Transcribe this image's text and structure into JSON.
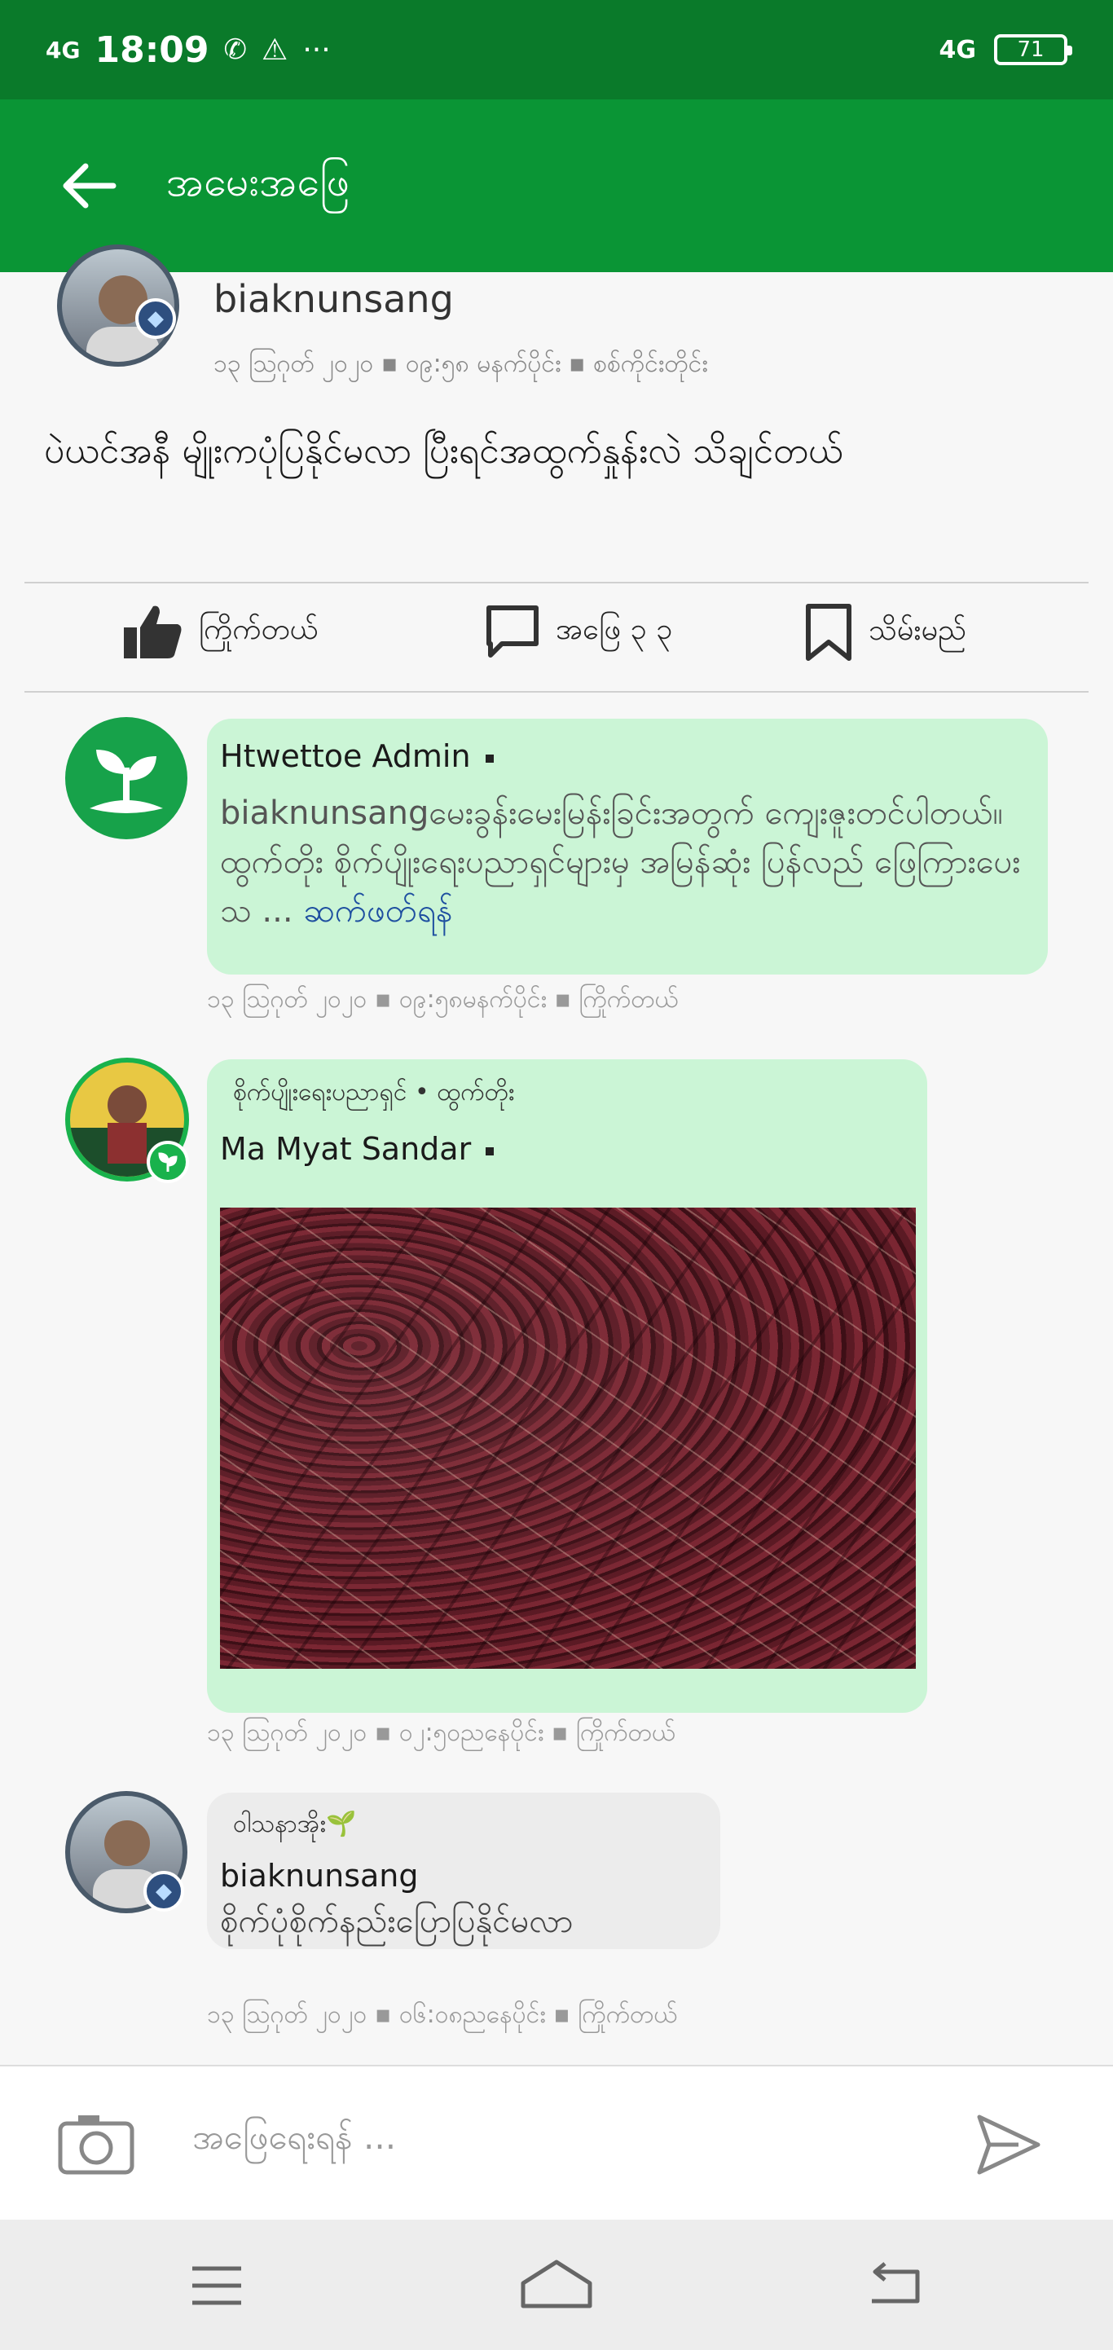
{
  "status": {
    "signal": "4G",
    "time": "18:09",
    "network_right": "4G",
    "battery": "71"
  },
  "header": {
    "title": "အမေးအဖြေ"
  },
  "post": {
    "author": "biaknunsang",
    "meta": "၁၃ ဩဂုတ် ၂၀၂၀ ▪ ၀၉:၅၈ မနက်ပိုင်း ▪ စစ်ကိုင်းတိုင်း",
    "body": "ပဲယင်အနီ မျိုးကပုံပြနိုင်မလာ ပြီးရင်အထွက်နှုန်းလဲ သိချင်တယ်",
    "actions": {
      "like": "ကြိုက်တယ်",
      "answers": "အဖြေ ၃ ၃",
      "save": "သိမ်းမည်"
    }
  },
  "comments": [
    {
      "name": "Htwettoe Admin",
      "text": "biaknunsangမေးခွန်းမေးမြန်းခြင်းအတွက် ကျေးဇူးတင်ပါတယ်။ ထွက်တိုး စိုက်ပျိုးရေးပညာရှင်များမှ အမြန်ဆုံး ပြန်လည် ဖြေကြားပေးသ ...",
      "see_more": "ဆက်ဖတ်ရန်",
      "meta": "၁၃ ဩဂုတ် ၂၀၂၀ ▪ ၀၉:၅၈မနက်ပိုင်း ▪ ကြိုက်တယ်"
    },
    {
      "role": "စိုက်ပျိုးရေးပညာရှင် • ထွက်တိုး",
      "name": "Ma Myat Sandar",
      "meta": "၁၃ ဩဂုတ် ၂၀၂၀ ▪ ၀၂:၅၀ညနေပိုင်း ▪ ကြိုက်တယ်"
    },
    {
      "role": "ဝါသနာအိုး🌱",
      "name": "biaknunsang",
      "text": "စိုက်ပုံစိုက်နည်းပြောပြနိုင်မလာ",
      "meta": "၁၃ ဩဂုတ် ၂၀၂၀ ▪ ၀၆:၀၈ညနေပိုင်း ▪ ကြိုက်တယ်"
    }
  ],
  "composer": {
    "placeholder": "အဖြေရေးရန် ..."
  },
  "colors": {
    "primary": "#0a9535",
    "status_bar": "#0a7a2a",
    "bubble_green": "#cbf5d6",
    "link": "#1e4fa0"
  }
}
